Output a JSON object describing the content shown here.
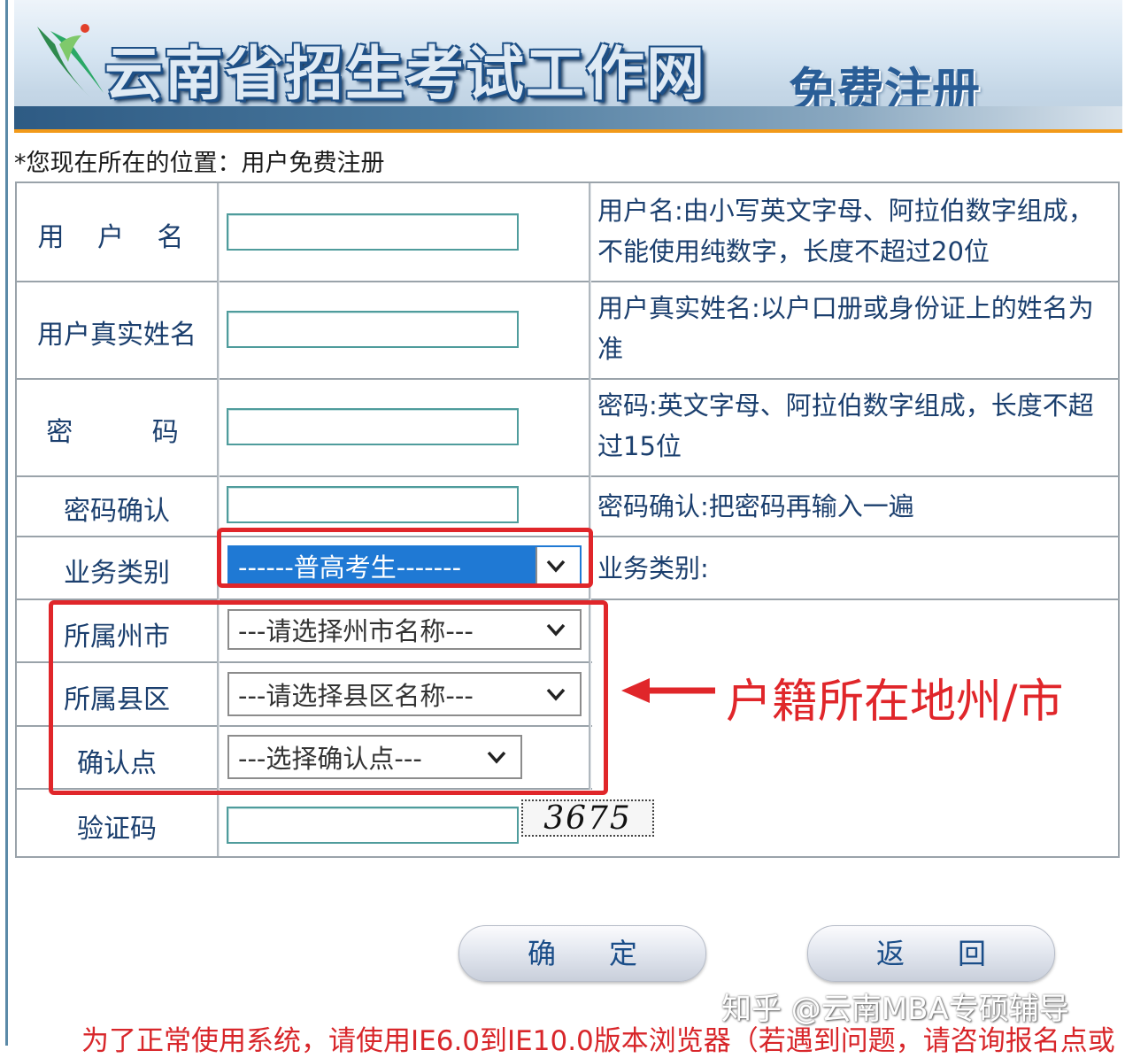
{
  "header": {
    "site_title": "云南省招生考试工作网",
    "page_heading": "免费注册"
  },
  "location_text": "*您现在所在的位置：用户免费注册",
  "form": {
    "username": {
      "label": "用 户 名",
      "hint": "用户名:由小写英文字母、阿拉伯数字组成，不能使用纯数字，长度不超过20位",
      "value": ""
    },
    "realname": {
      "label": "用户真实姓名",
      "hint": "用户真实姓名:以户口册或身份证上的姓名为准",
      "value": ""
    },
    "password": {
      "label": "密 码",
      "hint": "密码:英文字母、阿拉伯数字组成，长度不超过15位",
      "value": ""
    },
    "password_confirm": {
      "label": "密码确认",
      "hint": "密码确认:把密码再输入一遍",
      "value": ""
    },
    "business_type": {
      "label": "业务类别",
      "selected": "------普高考生-------",
      "hint": "业务类别:"
    },
    "prefecture": {
      "label": "所属州市",
      "selected": "---请选择州市名称---"
    },
    "county": {
      "label": "所属县区",
      "selected": "---请选择县区名称---"
    },
    "confirm_point": {
      "label": "确认点",
      "selected": "---选择确认点---"
    },
    "captcha": {
      "label": "验证码",
      "value": "",
      "code": "3675"
    }
  },
  "annotation": "户籍所在地州/市",
  "buttons": {
    "confirm": "确定",
    "back": "返回"
  },
  "watermark": "知乎 @云南MBA专硕辅导",
  "notice": "为了正常使用系统，请使用IE6.0到IE10.0版本浏览器（若遇到问题，请咨询报名点或",
  "colors": {
    "highlight_red": "#e0262a",
    "label_blue": "#1b3f6e",
    "banner_orange": "#f29a1a",
    "selected_blue": "#1f79d4"
  }
}
